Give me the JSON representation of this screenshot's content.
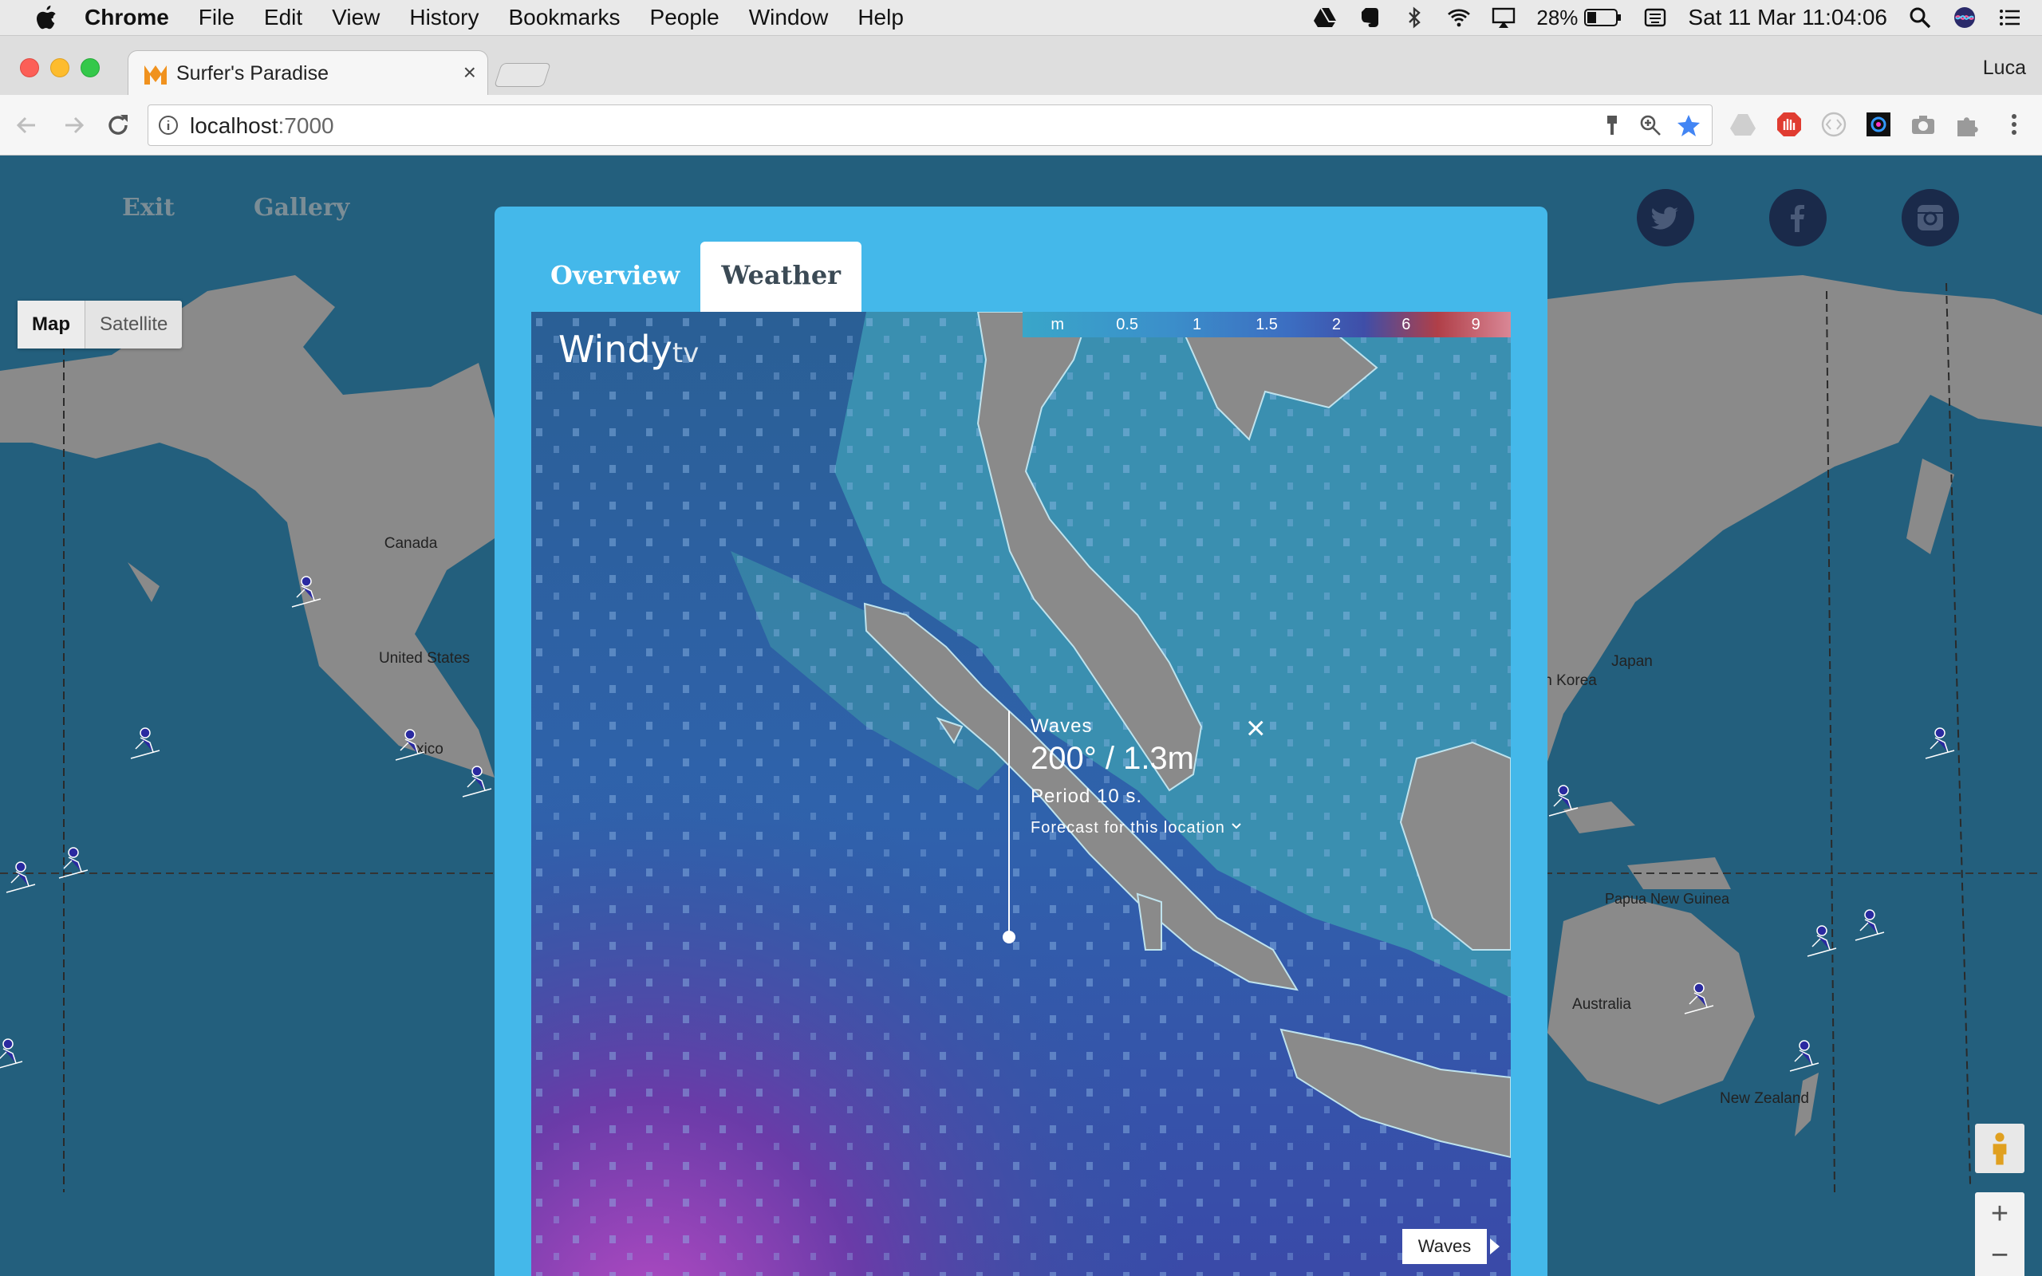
{
  "menubar": {
    "app": "Chrome",
    "menus": [
      "File",
      "Edit",
      "View",
      "History",
      "Bookmarks",
      "People",
      "Window",
      "Help"
    ],
    "battery": "28%",
    "clock": "Sat 11 Mar  11:04:06"
  },
  "browser": {
    "tab_title": "Surfer's Paradise",
    "profile": "Luca",
    "url_host": "localhost",
    "url_port": ":7000"
  },
  "page": {
    "nav": {
      "exit": "Exit",
      "gallery": "Gallery"
    },
    "map_type": {
      "map": "Map",
      "satellite": "Satellite"
    },
    "map_labels": {
      "canada": "Canada",
      "united_states": "United States",
      "mexico": "xico",
      "japan": "Japan",
      "south_korea": "th Korea",
      "papua": "Papua New Guinea",
      "australia": "Australia",
      "new_zealand": "New Zealand"
    },
    "zoom": {
      "in": "+",
      "out": "−"
    }
  },
  "modal": {
    "tabs": {
      "overview": "Overview",
      "weather": "Weather"
    },
    "windy": {
      "brand": "Windy",
      "brand_suffix": "tv",
      "legend": [
        "m",
        "0.5",
        "1",
        "1.5",
        "2",
        "6",
        "9"
      ],
      "popup": {
        "label": "Waves",
        "value": "200° / 1.3m",
        "period": "Period 10 s.",
        "forecast": "Forecast for this location",
        "close": "×"
      },
      "layer": "Waves"
    }
  },
  "colors": {
    "modal_blue": "#44b8ea",
    "ocean": "#235f7d",
    "land": "#8a8a8a"
  }
}
